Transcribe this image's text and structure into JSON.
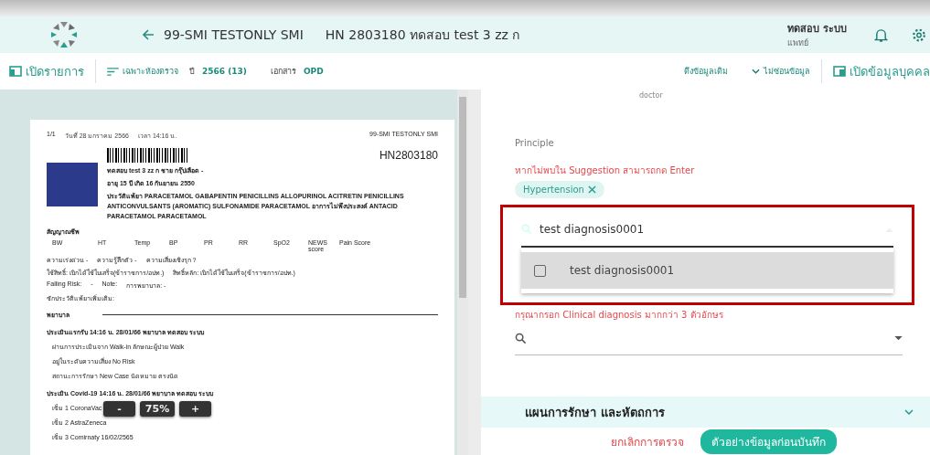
{
  "header": {
    "title": "99-SMI TESTONLY SMI",
    "patient": "HN 2803180 ทดสอบ test 3 zz ก",
    "user_name": "ทดสอบ ระบบ",
    "user_role": "แพทย์"
  },
  "toolbar": {
    "open_list": "เปิดรายการ",
    "filter": "เฉพาะห้องตรวจ",
    "year_label": "ปี",
    "year": "2566 (13)",
    "doc_label": "เอกสาร",
    "doc": "OPD",
    "pull_data": "ดึงข้อมูลเดิม",
    "hide_data": "ไม่ซ่อนข้อมูล",
    "open_person": "เปิดข้อมูลบุคคล"
  },
  "document": {
    "page": "1/1",
    "date": "วันที่ 28 มกราคม 2566",
    "time": "เวลา 14:16 น.",
    "clinic": "99-SMI TESTONLY SMI",
    "hn": "HN2803180",
    "patient_lines": [
      "ทดสอบ test 3 zz ก   ชาย   กรุ๊ปเลือด -",
      "อายุ 15 ปี   เกิด 16 กันยายน 2550",
      "ประวัติแพ้ยา PARACETAMOL GABAPENTIN PENICILLINS ALLOPURINOL ACITRETIN PENICILLINS ANTICONVULSANTS (AROMATIC) SULFONAMIDE PARACETAMOL    อาการไม่พึงประสงค์ ANTACID PARACETAMOL PARACETAMOL"
    ],
    "vitals_title": "สัญญาณชีพ",
    "vitals": [
      "BW",
      "HT",
      "Temp",
      "BP",
      "PR",
      "RR",
      "SpO2",
      "NEWS score",
      "Pain Score"
    ],
    "info_rows": [
      [
        "ความเร่งด่วน -",
        "ความรู้สึกตัว -",
        "ความเสี่ยงเชิงรุก ?"
      ],
      [
        "ใช้สิทธิ์: เบิกได้ใช้ใบเสร็จ(ข้าราชการ/อปท.)",
        "สิทธิ์หลัก: เบิกได้ใช้ใบเสร็จ(ข้าราชการ/อปท.)"
      ],
      [
        "Falling Risk:",
        "-",
        "Note:",
        "การพยาบาล: -"
      ],
      [
        "ซักประวัติแพ้ยาเพิ่มเติม:"
      ]
    ],
    "nurse_title": "พยาบาล",
    "assessments": [
      {
        "title": "ประเมินแรกรับ  14:16 น. 28/01/66 พยาบาล ทดสอบ ระบบ",
        "lines": [
          "ผ่านการประเมินจาก Walk-in  ลักษณะผู้ป่วย Walk",
          "อยู่ในระดับความเสี่ยง No Risk",
          "สถานะการรักษา New Case  นัดหมาย ตรงนัด"
        ]
      },
      {
        "title": "ประเมิน Covid-19  14:16 น. 28/01/66 พยาบาล ทดสอบ ระบบ",
        "lines": [
          "เข็ม 1  CoronaVac",
          "เข็ม 2  AstraZeneca",
          "เข็ม 3  Comirnaty  16/02/2565"
        ]
      }
    ]
  },
  "zoom": {
    "minus": "-",
    "level": "75%",
    "plus": "+"
  },
  "form": {
    "role": "doctor",
    "principle_label": "Principle",
    "hint": "หากไม่พบใน Suggestion สามารถกด Enter",
    "chips": [
      "Hypertension"
    ],
    "search_value": "test diagnosis0001",
    "options": [
      {
        "label": "test diagnosis0001",
        "checked": false
      }
    ],
    "error": "กรุณากรอก Clinical diagnosis มากกว่า 3 ตัวอักษร"
  },
  "section": {
    "title": "แผนการรักษา และหัตถการ",
    "expanded": false
  },
  "buttons": {
    "cancel": "ยกเลิกการตรวจ",
    "preview": "ตัวอย่างข้อมูลก่อนบันทึก"
  }
}
